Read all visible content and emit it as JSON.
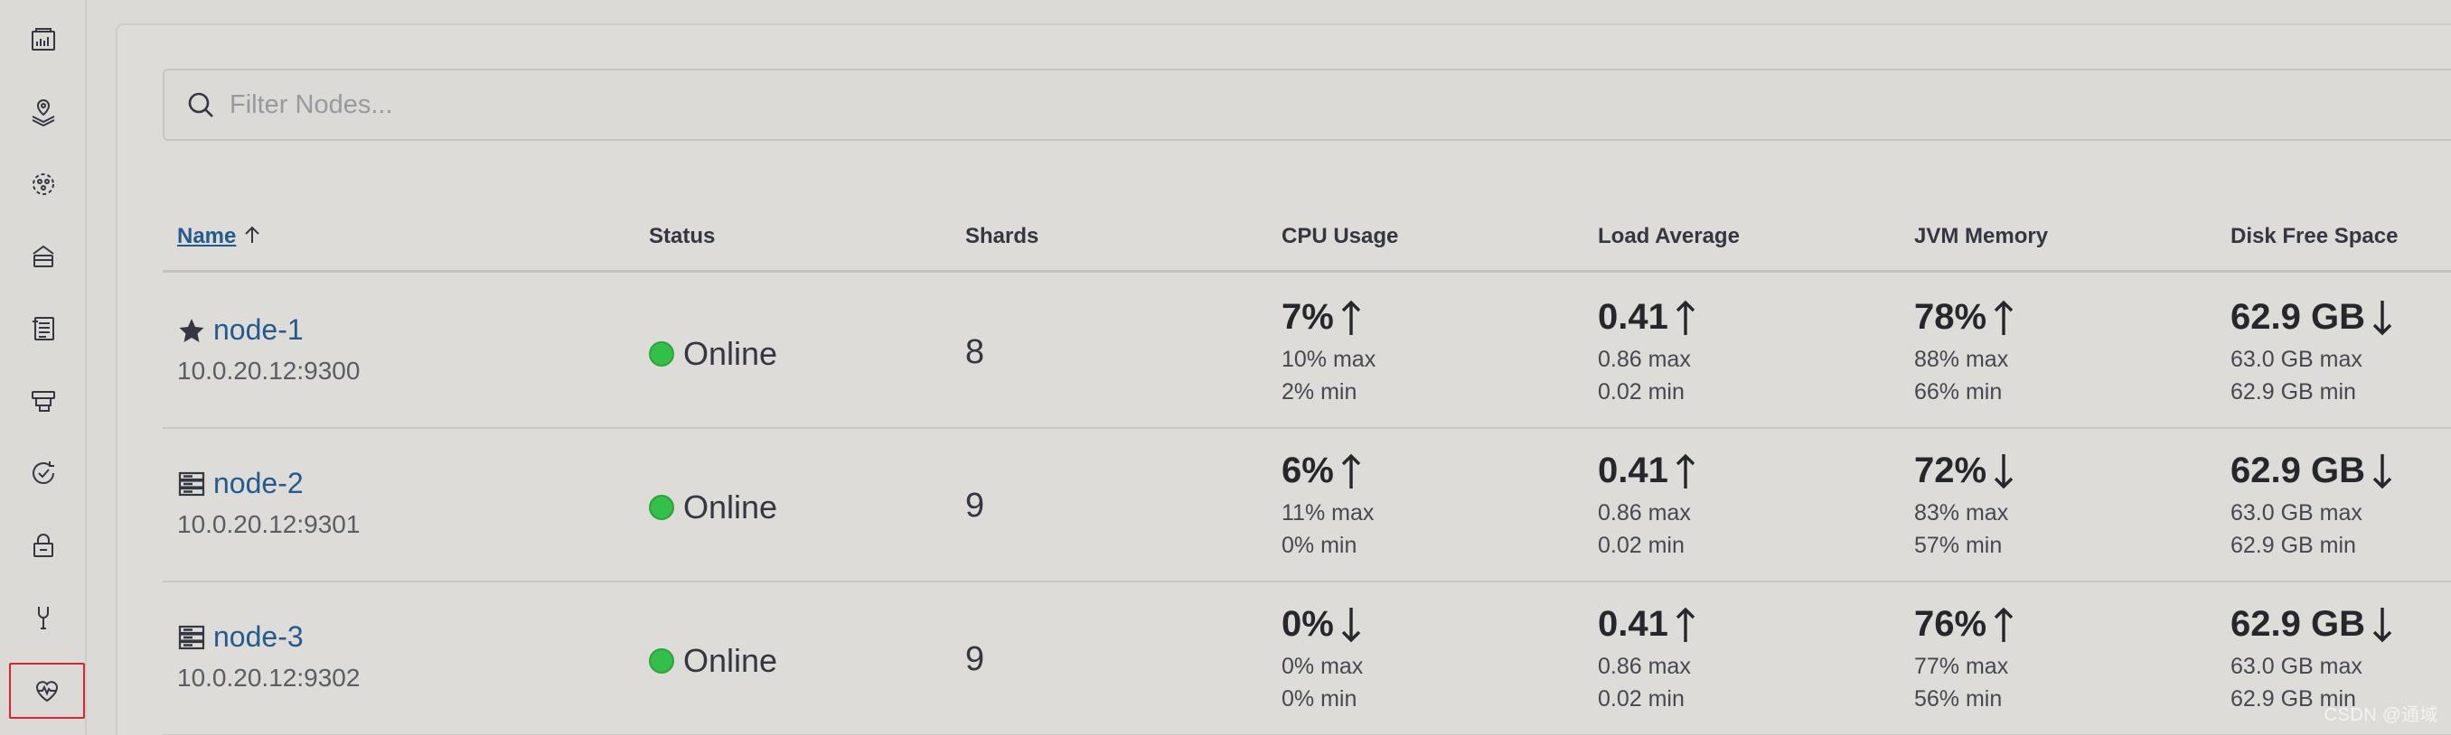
{
  "sidebar": {
    "icons": [
      "dashboard-icon",
      "maps-icon",
      "machine-learning-icon",
      "stack-management-icon",
      "logs-icon",
      "ingest-icon",
      "uptime-icon",
      "security-icon",
      "dev-tools-icon",
      "stack-monitoring-icon"
    ],
    "active": "stack-monitoring-icon",
    "active_border_color": "#d9242b"
  },
  "filter": {
    "placeholder": "Filter Nodes...",
    "value": ""
  },
  "table": {
    "columns": {
      "name": "Name",
      "status": "Status",
      "shards": "Shards",
      "cpu": "CPU Usage",
      "load": "Load Average",
      "jvm": "JVM Memory",
      "disk": "Disk Free Space"
    },
    "sort": {
      "column": "name",
      "direction": "ascending"
    },
    "rows": [
      {
        "icon": "star-icon",
        "name": "node-1",
        "address": "10.0.20.12:9300",
        "status": "Online",
        "shards": "8",
        "cpu": {
          "value": "7%",
          "trend": "up",
          "max": "10% max",
          "min": "2% min"
        },
        "load": {
          "value": "0.41",
          "trend": "up",
          "max": "0.86 max",
          "min": "0.02 min"
        },
        "jvm": {
          "value": "78%",
          "trend": "up",
          "max": "88% max",
          "min": "66% min"
        },
        "disk": {
          "value": "62.9 GB",
          "trend": "down",
          "max": "63.0 GB max",
          "min": "62.9 GB min"
        }
      },
      {
        "icon": "server-icon",
        "name": "node-2",
        "address": "10.0.20.12:9301",
        "status": "Online",
        "shards": "9",
        "cpu": {
          "value": "6%",
          "trend": "up",
          "max": "11% max",
          "min": "0% min"
        },
        "load": {
          "value": "0.41",
          "trend": "up",
          "max": "0.86 max",
          "min": "0.02 min"
        },
        "jvm": {
          "value": "72%",
          "trend": "down",
          "max": "83% max",
          "min": "57% min"
        },
        "disk": {
          "value": "62.9 GB",
          "trend": "down",
          "max": "63.0 GB max",
          "min": "62.9 GB min"
        }
      },
      {
        "icon": "server-icon",
        "name": "node-3",
        "address": "10.0.20.12:9302",
        "status": "Online",
        "shards": "9",
        "cpu": {
          "value": "0%",
          "trend": "down",
          "max": "0% max",
          "min": "0% min"
        },
        "load": {
          "value": "0.41",
          "trend": "up",
          "max": "0.86 max",
          "min": "0.02 min"
        },
        "jvm": {
          "value": "76%",
          "trend": "up",
          "max": "77% max",
          "min": "56% min"
        },
        "disk": {
          "value": "62.9 GB",
          "trend": "down",
          "max": "63.0 GB max",
          "min": "62.9 GB min"
        }
      }
    ]
  },
  "colors": {
    "link": "#245b8e",
    "online": "#33c048",
    "background": "#dcdad6"
  },
  "watermark": "CSDN @通域"
}
